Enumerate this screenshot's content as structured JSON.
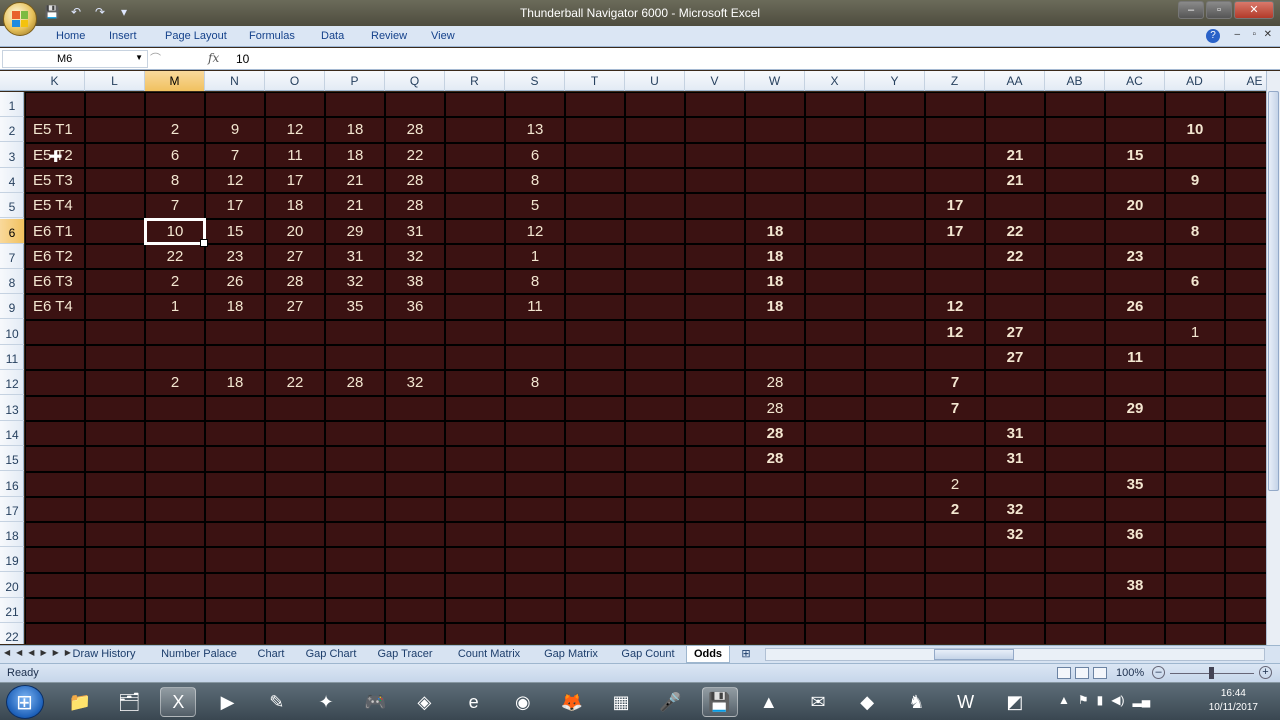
{
  "window": {
    "title": "Thunderball Navigator 6000 - Microsoft Excel"
  },
  "qat": {
    "save_icon": "save-icon",
    "undo_icon": "undo-icon",
    "redo_icon": "redo-icon"
  },
  "ribbon": {
    "tabs": [
      "Home",
      "Insert",
      "Page Layout",
      "Formulas",
      "Data",
      "Review",
      "View"
    ]
  },
  "formula_bar": {
    "name_box": "M6",
    "fx": "fx",
    "value": "10"
  },
  "columns": [
    "K",
    "L",
    "M",
    "N",
    "O",
    "P",
    "Q",
    "R",
    "S",
    "T",
    "U",
    "V",
    "W",
    "X",
    "Y",
    "Z",
    "AA",
    "AB",
    "AC",
    "AD",
    "AE"
  ],
  "selected_column": "M",
  "rows": [
    "1",
    "2",
    "3",
    "4",
    "5",
    "6",
    "7",
    "8",
    "9",
    "10",
    "11",
    "12",
    "13",
    "14",
    "15",
    "16",
    "17",
    "18",
    "19",
    "20",
    "21",
    "22"
  ],
  "selected_row": "6",
  "cells": [
    {
      "c": "K",
      "r": 2,
      "v": "E5 T1",
      "lbl": true
    },
    {
      "c": "M",
      "r": 2,
      "v": "2"
    },
    {
      "c": "N",
      "r": 2,
      "v": "9"
    },
    {
      "c": "O",
      "r": 2,
      "v": "12"
    },
    {
      "c": "P",
      "r": 2,
      "v": "18"
    },
    {
      "c": "Q",
      "r": 2,
      "v": "28"
    },
    {
      "c": "S",
      "r": 2,
      "v": "13"
    },
    {
      "c": "AD",
      "r": 2,
      "v": "10",
      "b": true
    },
    {
      "c": "K",
      "r": 3,
      "v": "E5 T2",
      "lbl": true
    },
    {
      "c": "M",
      "r": 3,
      "v": "6"
    },
    {
      "c": "N",
      "r": 3,
      "v": "7"
    },
    {
      "c": "O",
      "r": 3,
      "v": "11"
    },
    {
      "c": "P",
      "r": 3,
      "v": "18"
    },
    {
      "c": "Q",
      "r": 3,
      "v": "22"
    },
    {
      "c": "S",
      "r": 3,
      "v": "6"
    },
    {
      "c": "AA",
      "r": 3,
      "v": "21",
      "b": true
    },
    {
      "c": "AC",
      "r": 3,
      "v": "15",
      "b": true
    },
    {
      "c": "K",
      "r": 4,
      "v": "E5 T3",
      "lbl": true
    },
    {
      "c": "M",
      "r": 4,
      "v": "8"
    },
    {
      "c": "N",
      "r": 4,
      "v": "12"
    },
    {
      "c": "O",
      "r": 4,
      "v": "17"
    },
    {
      "c": "P",
      "r": 4,
      "v": "21"
    },
    {
      "c": "Q",
      "r": 4,
      "v": "28"
    },
    {
      "c": "S",
      "r": 4,
      "v": "8"
    },
    {
      "c": "AA",
      "r": 4,
      "v": "21",
      "b": true
    },
    {
      "c": "AD",
      "r": 4,
      "v": "9",
      "b": true
    },
    {
      "c": "K",
      "r": 5,
      "v": "E5 T4",
      "lbl": true
    },
    {
      "c": "M",
      "r": 5,
      "v": "7"
    },
    {
      "c": "N",
      "r": 5,
      "v": "17"
    },
    {
      "c": "O",
      "r": 5,
      "v": "18"
    },
    {
      "c": "P",
      "r": 5,
      "v": "21"
    },
    {
      "c": "Q",
      "r": 5,
      "v": "28"
    },
    {
      "c": "S",
      "r": 5,
      "v": "5"
    },
    {
      "c": "Z",
      "r": 5,
      "v": "17",
      "b": true
    },
    {
      "c": "AC",
      "r": 5,
      "v": "20",
      "b": true
    },
    {
      "c": "K",
      "r": 6,
      "v": "E6 T1",
      "lbl": true
    },
    {
      "c": "M",
      "r": 6,
      "v": "10"
    },
    {
      "c": "N",
      "r": 6,
      "v": "15"
    },
    {
      "c": "O",
      "r": 6,
      "v": "20"
    },
    {
      "c": "P",
      "r": 6,
      "v": "29"
    },
    {
      "c": "Q",
      "r": 6,
      "v": "31"
    },
    {
      "c": "S",
      "r": 6,
      "v": "12"
    },
    {
      "c": "W",
      "r": 6,
      "v": "18",
      "b": true
    },
    {
      "c": "Z",
      "r": 6,
      "v": "17",
      "b": true
    },
    {
      "c": "AA",
      "r": 6,
      "v": "22",
      "b": true
    },
    {
      "c": "AD",
      "r": 6,
      "v": "8",
      "b": true
    },
    {
      "c": "K",
      "r": 7,
      "v": "E6 T2",
      "lbl": true
    },
    {
      "c": "M",
      "r": 7,
      "v": "22"
    },
    {
      "c": "N",
      "r": 7,
      "v": "23"
    },
    {
      "c": "O",
      "r": 7,
      "v": "27"
    },
    {
      "c": "P",
      "r": 7,
      "v": "31"
    },
    {
      "c": "Q",
      "r": 7,
      "v": "32"
    },
    {
      "c": "S",
      "r": 7,
      "v": "1"
    },
    {
      "c": "W",
      "r": 7,
      "v": "18",
      "b": true
    },
    {
      "c": "AA",
      "r": 7,
      "v": "22",
      "b": true
    },
    {
      "c": "AC",
      "r": 7,
      "v": "23",
      "b": true
    },
    {
      "c": "K",
      "r": 8,
      "v": "E6 T3",
      "lbl": true
    },
    {
      "c": "M",
      "r": 8,
      "v": "2"
    },
    {
      "c": "N",
      "r": 8,
      "v": "26"
    },
    {
      "c": "O",
      "r": 8,
      "v": "28"
    },
    {
      "c": "P",
      "r": 8,
      "v": "32"
    },
    {
      "c": "Q",
      "r": 8,
      "v": "38"
    },
    {
      "c": "S",
      "r": 8,
      "v": "8"
    },
    {
      "c": "W",
      "r": 8,
      "v": "18",
      "b": true
    },
    {
      "c": "AD",
      "r": 8,
      "v": "6",
      "b": true
    },
    {
      "c": "K",
      "r": 9,
      "v": "E6 T4",
      "lbl": true
    },
    {
      "c": "M",
      "r": 9,
      "v": "1"
    },
    {
      "c": "N",
      "r": 9,
      "v": "18"
    },
    {
      "c": "O",
      "r": 9,
      "v": "27"
    },
    {
      "c": "P",
      "r": 9,
      "v": "35"
    },
    {
      "c": "Q",
      "r": 9,
      "v": "36"
    },
    {
      "c": "S",
      "r": 9,
      "v": "11"
    },
    {
      "c": "W",
      "r": 9,
      "v": "18",
      "b": true
    },
    {
      "c": "Z",
      "r": 9,
      "v": "12",
      "b": true
    },
    {
      "c": "AC",
      "r": 9,
      "v": "26",
      "b": true
    },
    {
      "c": "Z",
      "r": 10,
      "v": "12",
      "b": true
    },
    {
      "c": "AA",
      "r": 10,
      "v": "27",
      "b": true
    },
    {
      "c": "AD",
      "r": 10,
      "v": "1"
    },
    {
      "c": "AA",
      "r": 11,
      "v": "27",
      "b": true
    },
    {
      "c": "AC",
      "r": 11,
      "v": "11",
      "b": true
    },
    {
      "c": "M",
      "r": 12,
      "v": "2"
    },
    {
      "c": "N",
      "r": 12,
      "v": "18"
    },
    {
      "c": "O",
      "r": 12,
      "v": "22"
    },
    {
      "c": "P",
      "r": 12,
      "v": "28"
    },
    {
      "c": "Q",
      "r": 12,
      "v": "32"
    },
    {
      "c": "S",
      "r": 12,
      "v": "8"
    },
    {
      "c": "W",
      "r": 12,
      "v": "28"
    },
    {
      "c": "Z",
      "r": 12,
      "v": "7",
      "b": true
    },
    {
      "c": "W",
      "r": 13,
      "v": "28"
    },
    {
      "c": "Z",
      "r": 13,
      "v": "7",
      "b": true
    },
    {
      "c": "AC",
      "r": 13,
      "v": "29",
      "b": true
    },
    {
      "c": "W",
      "r": 14,
      "v": "28",
      "b": true
    },
    {
      "c": "AA",
      "r": 14,
      "v": "31",
      "b": true
    },
    {
      "c": "W",
      "r": 15,
      "v": "28",
      "b": true
    },
    {
      "c": "AA",
      "r": 15,
      "v": "31",
      "b": true
    },
    {
      "c": "Z",
      "r": 16,
      "v": "2"
    },
    {
      "c": "AC",
      "r": 16,
      "v": "35",
      "b": true
    },
    {
      "c": "Z",
      "r": 17,
      "v": "2",
      "b": true
    },
    {
      "c": "AA",
      "r": 17,
      "v": "32",
      "b": true
    },
    {
      "c": "AA",
      "r": 18,
      "v": "32",
      "b": true
    },
    {
      "c": "AC",
      "r": 18,
      "v": "36",
      "b": true
    },
    {
      "c": "AC",
      "r": 20,
      "v": "38",
      "b": true
    }
  ],
  "sheet_tabs": [
    "Draw History",
    "Number Palace",
    "Chart",
    "Gap Chart",
    "Gap Tracer",
    "Count Matrix",
    "Gap Matrix",
    "Gap Count",
    "Odds"
  ],
  "active_sheet": "Odds",
  "status": {
    "ready": "Ready",
    "zoom": "100%"
  },
  "taskbar": {
    "icons": [
      "folder-icon",
      "explorer-icon",
      "excel-icon",
      "media-player-icon",
      "tool-icon",
      "pinwheel-icon",
      "gamepad-icon",
      "network-icon",
      "ie-icon",
      "chrome-icon",
      "firefox-icon",
      "calculator-icon",
      "microphone-icon",
      "save-icon",
      "vlc-icon",
      "mail-icon",
      "kodi-icon",
      "chess-icon",
      "word-icon",
      "paint-icon"
    ],
    "time": "16:44",
    "date": "10/11/2017"
  },
  "colors": {
    "sheet_bg": "#3b1212",
    "cell_text": "#f3e6d0",
    "grid_line": "#000000",
    "selection": "#ffffff"
  }
}
